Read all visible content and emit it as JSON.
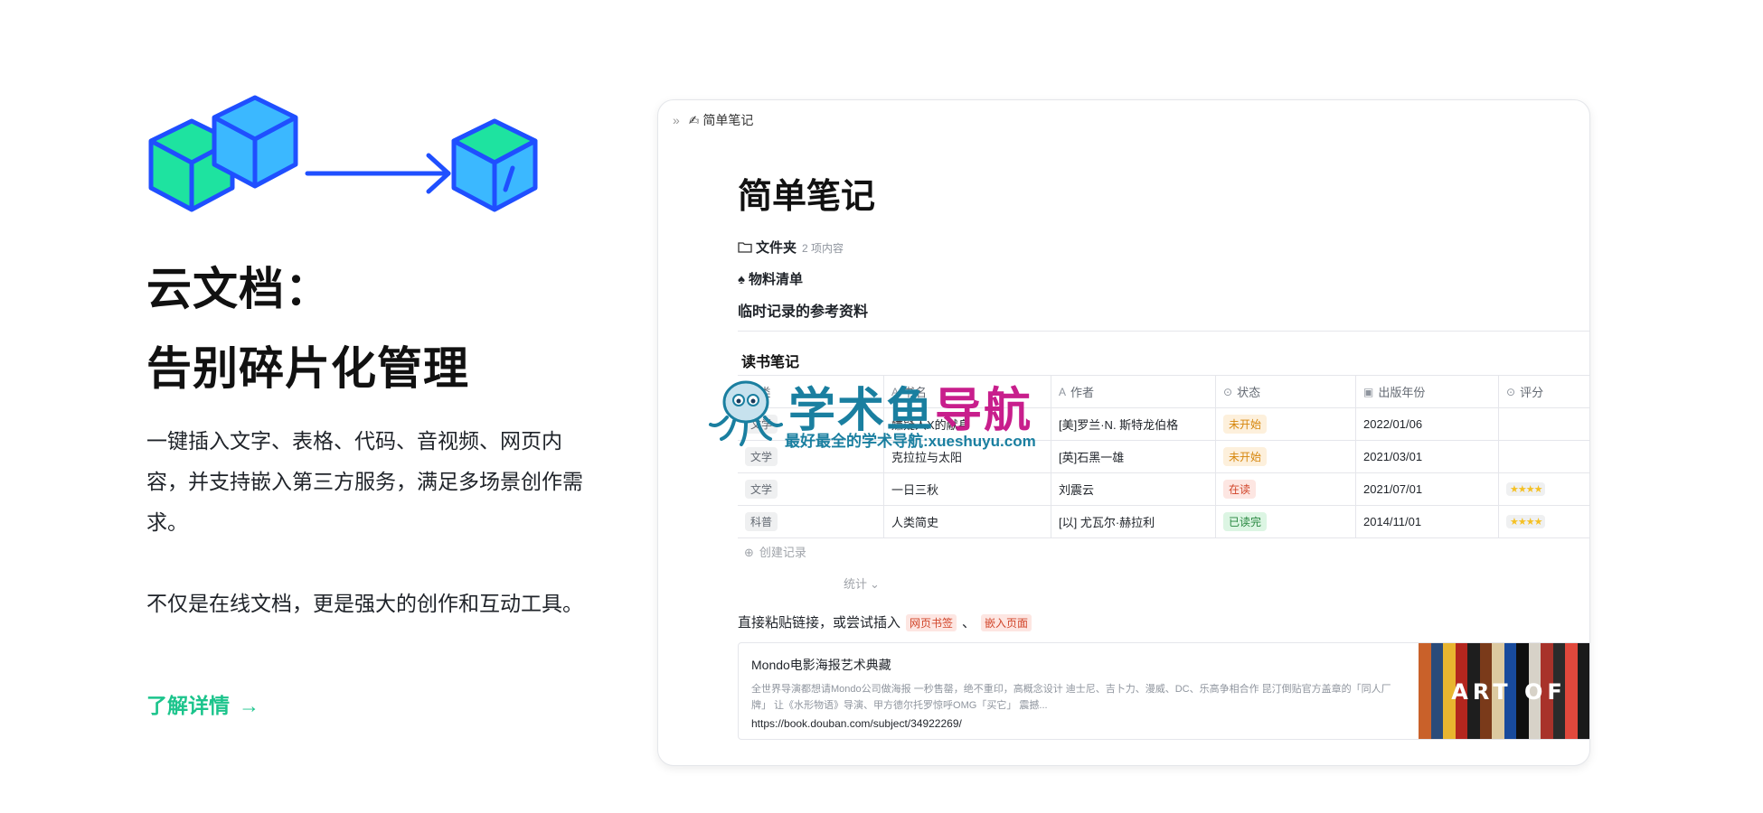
{
  "hero": {
    "title_line1": "云文档：",
    "title_line2": "告别碎片化管理",
    "desc1": "一键插入文字、表格、代码、音视频、网页内容，并支持嵌入第三方服务，满足多场景创作需求。",
    "desc2": "不仅是在线文档，更是强大的创作和互动工具。",
    "learn_more": "了解详情",
    "learn_more_arrow": "→"
  },
  "doc": {
    "breadcrumb_chevron": "»",
    "breadcrumb": "✍ 简单笔记",
    "title": "简单笔记",
    "folder_label": "文件夹",
    "folder_sub": "2 项内容",
    "materials": "物料清单",
    "references": "临时记录的参考资料",
    "table_title": "读书笔记",
    "columns": [
      "类",
      "书名",
      "作者",
      "状态",
      "出版年份",
      "评分"
    ],
    "rows": [
      {
        "category": "文学",
        "book": "嫌疑人X的献身",
        "author": "[美]罗兰·N. 斯特龙伯格",
        "status": "未开始",
        "status_color": "orange",
        "year": "2022/01/06",
        "rating": ""
      },
      {
        "category": "文学",
        "book": "克拉拉与太阳",
        "author": "[英]石黑一雄",
        "status": "未开始",
        "status_color": "orange",
        "year": "2021/03/01",
        "rating": ""
      },
      {
        "category": "文学",
        "book": "一日三秋",
        "author": "刘震云",
        "status": "在读",
        "status_color": "red",
        "year": "2021/07/01",
        "rating": "★★★★"
      },
      {
        "category": "科普",
        "book": "人类简史",
        "author": "[以] 尤瓦尔·赫拉利",
        "status": "已读完",
        "status_color": "green",
        "year": "2014/11/01",
        "rating": "★★★★"
      }
    ],
    "add_record": "创建记录",
    "summary": "统计",
    "paste_text": "直接粘贴链接，或尝试插入",
    "chip1": "网页书签",
    "separator": "、",
    "chip2": "嵌入页面",
    "link_title": "Mondo电影海报艺术典藏",
    "link_desc": "全世界导演都想请Mondo公司做海报 一秒售罄，绝不重印，高概念设计 迪士尼、吉卜力、漫威、DC、乐高争相合作 昆汀倒贴官方盖章的「同人厂牌」 让《水形物语》导演、甲方德尔托罗惊呼OMG「买它」 震撼...",
    "link_url": "https://book.douban.com/subject/34922269/",
    "link_image_text": "ART OF"
  },
  "watermark": {
    "line1_a": "学术鱼",
    "line1_b": "导航",
    "line2": "最好最全的学术导航:xueshuyu.com"
  },
  "colors": {
    "accent_green": "#1cc48c",
    "cube_green": "#1ee3a0",
    "cube_blue": "#3bb8ff",
    "stroke_blue": "#1f4fff"
  }
}
